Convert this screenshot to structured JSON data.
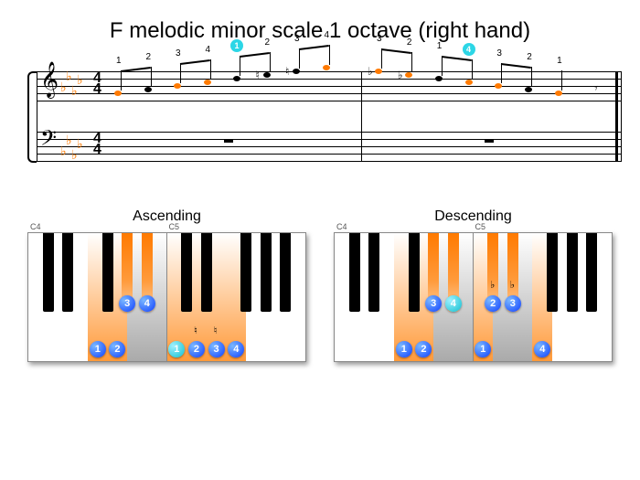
{
  "title": "F melodic minor scale 1 octave (right hand)",
  "score": {
    "time_signature": {
      "top": "4",
      "bottom": "4"
    },
    "key_signature_flats": 4,
    "ascending": {
      "notes": [
        {
          "name": "F4",
          "finger": "1",
          "highlighted": true,
          "accidental": null
        },
        {
          "name": "G4",
          "finger": "2",
          "highlighted": false,
          "accidental": null
        },
        {
          "name": "Ab4",
          "finger": "3",
          "highlighted": true,
          "accidental": null
        },
        {
          "name": "Bb4",
          "finger": "4",
          "highlighted": true,
          "accidental": null
        },
        {
          "name": "C5",
          "finger": "1",
          "highlighted": false,
          "accidental": null,
          "circled": true
        },
        {
          "name": "D5",
          "finger": "2",
          "highlighted": false,
          "accidental": "♮"
        },
        {
          "name": "E5",
          "finger": "3",
          "highlighted": false,
          "accidental": "♮"
        },
        {
          "name": "F5",
          "finger": "4",
          "highlighted": true,
          "accidental": null
        }
      ]
    },
    "descending": {
      "notes": [
        {
          "name": "Eb5",
          "finger": "3",
          "highlighted": true,
          "accidental": "♭"
        },
        {
          "name": "Db5",
          "finger": "2",
          "highlighted": true,
          "accidental": "♭"
        },
        {
          "name": "C5",
          "finger": "1",
          "highlighted": false,
          "accidental": null
        },
        {
          "name": "Bb4",
          "finger": "4",
          "highlighted": true,
          "accidental": null,
          "circled": true
        },
        {
          "name": "Ab4",
          "finger": "3",
          "highlighted": true,
          "accidental": null
        },
        {
          "name": "G4",
          "finger": "2",
          "highlighted": false,
          "accidental": null
        },
        {
          "name": "F4",
          "finger": "1",
          "highlighted": true,
          "accidental": null
        }
      ],
      "rest": "eighth"
    }
  },
  "keyboards": {
    "ascending": {
      "title": "Ascending",
      "octave_labels": [
        "C4",
        "C5"
      ],
      "white_keys_highlight": [
        "F4",
        "G4",
        "C5",
        "D5",
        "E5",
        "F5"
      ],
      "white_keys_grey_range": [
        "F4",
        "F5"
      ],
      "black_keys_highlight": [
        "Ab4",
        "Bb4"
      ],
      "fingers": [
        {
          "key": "F4",
          "num": "1",
          "color": "blue"
        },
        {
          "key": "G4",
          "num": "2",
          "color": "blue"
        },
        {
          "key": "Ab4",
          "num": "3",
          "color": "blue"
        },
        {
          "key": "Bb4",
          "num": "4",
          "color": "blue"
        },
        {
          "key": "C5",
          "num": "1",
          "color": "cyan"
        },
        {
          "key": "D5",
          "num": "2",
          "color": "blue"
        },
        {
          "key": "E5",
          "num": "3",
          "color": "blue"
        },
        {
          "key": "F5",
          "num": "4",
          "color": "blue"
        }
      ],
      "accidentals_shown": [
        {
          "key": "D5",
          "sym": "♮"
        },
        {
          "key": "E5",
          "sym": "♮"
        }
      ]
    },
    "descending": {
      "title": "Descending",
      "octave_labels": [
        "C4",
        "C5"
      ],
      "white_keys_highlight": [
        "F4",
        "G4",
        "C5",
        "F5"
      ],
      "white_keys_grey_range": [
        "F4",
        "F5"
      ],
      "black_keys_highlight": [
        "Ab4",
        "Bb4",
        "Db5",
        "Eb5"
      ],
      "fingers": [
        {
          "key": "F4",
          "num": "1",
          "color": "blue"
        },
        {
          "key": "G4",
          "num": "2",
          "color": "blue"
        },
        {
          "key": "Ab4",
          "num": "3",
          "color": "blue"
        },
        {
          "key": "Bb4",
          "num": "4",
          "color": "cyan"
        },
        {
          "key": "C5",
          "num": "1",
          "color": "blue"
        },
        {
          "key": "Db5",
          "num": "2",
          "color": "blue"
        },
        {
          "key": "Eb5",
          "num": "3",
          "color": "blue"
        },
        {
          "key": "F5",
          "num": "4",
          "color": "blue"
        }
      ],
      "accidentals_shown": [
        {
          "key": "Db5",
          "sym": "♭"
        },
        {
          "key": "Eb5",
          "sym": "♭"
        }
      ]
    }
  }
}
